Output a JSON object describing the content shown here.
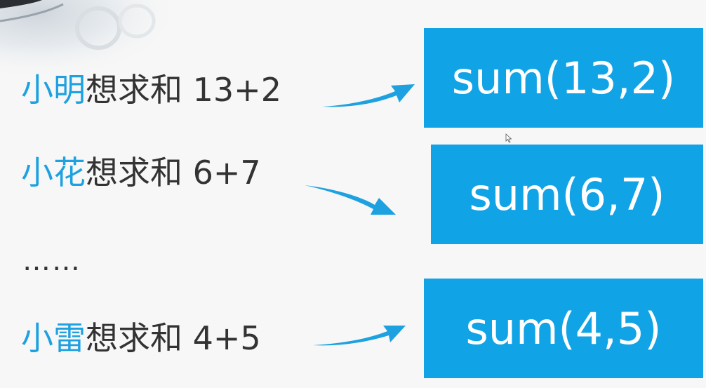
{
  "accent_color": "#1ea1e0",
  "box_color": "#10a3e6",
  "rows": [
    {
      "name": "小明",
      "rest": "想求和 13+2",
      "call": "sum(13,2)"
    },
    {
      "name": "小花",
      "rest": "想求和 6+7",
      "call": "sum(6,7)"
    },
    {
      "name": "小雷",
      "rest": "想求和 4+5",
      "call": "sum(4,5)"
    }
  ],
  "ellipsis": "……",
  "icons": {
    "arrow": "swoosh-arrow-icon",
    "cursor": "mouse-pointer-icon"
  }
}
